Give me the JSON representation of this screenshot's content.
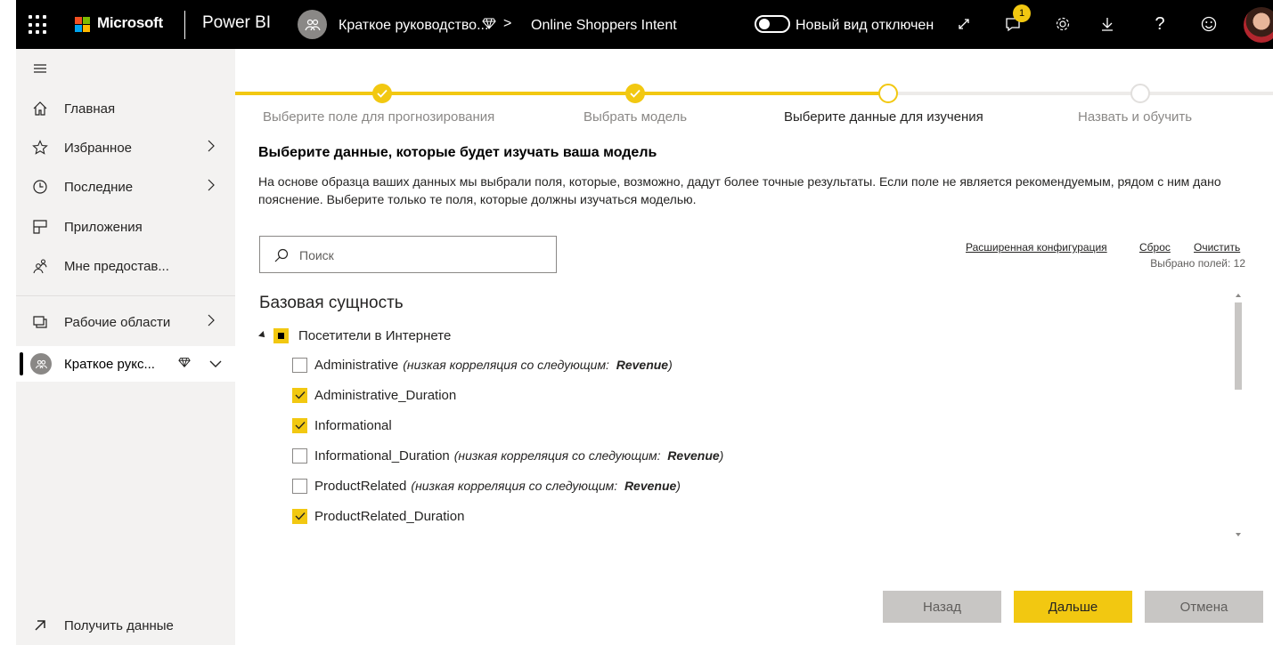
{
  "topbar": {
    "brand": "Microsoft",
    "app_name": "Power BI",
    "breadcrumb_workspace": "Краткое руководство...",
    "breadcrumb_sep": ">",
    "breadcrumb_item": "Online Shoppers Intent",
    "toggle_label": "Новый вид отключен",
    "notification_count": "1",
    "icons": [
      "waffle-icon",
      "expand-icon",
      "notifications-icon",
      "settings-icon",
      "download-icon",
      "help-icon",
      "feedback-icon"
    ]
  },
  "sidebar": {
    "items": [
      {
        "label": "Главная",
        "icon": "home-icon"
      },
      {
        "label": "Избранное",
        "icon": "star-icon"
      },
      {
        "label": "Последние",
        "icon": "clock-icon"
      },
      {
        "label": "Приложения",
        "icon": "apps-icon"
      },
      {
        "label": "Мне предостав...",
        "icon": "shared-icon"
      },
      {
        "label": "Рабочие области",
        "icon": "workspaces-icon"
      },
      {
        "label": "Краткое рукс...",
        "icon": "workspace-avatar"
      }
    ],
    "get_data": "Получить данные"
  },
  "steps": [
    {
      "label": "Выберите поле для прогнозирования",
      "state": "done"
    },
    {
      "label": "Выбрать модель",
      "state": "done"
    },
    {
      "label": "Выберите данные для изучения",
      "state": "current"
    },
    {
      "label": "Назвать и обучить",
      "state": "pending"
    }
  ],
  "main": {
    "title": "Выберите данные, которые будет изучать ваша модель",
    "description": "На основе образца ваших данных мы выбрали поля, которые, возможно, дадут более точные результаты. Если поле не является рекомендуемым, рядом с ним дано пояснение. Выберите только те поля, которые должны изучаться моделью.",
    "search_placeholder": "Поиск",
    "advanced_config": "Расширенная конфигурация",
    "reset": "Сброс",
    "clear": "Очистить",
    "selected_count": "Выбрано полей: 12",
    "entity_heading": "Базовая сущность",
    "root_entity": "Посетители в Интернете",
    "fields": [
      {
        "name": "Administrative",
        "checked": false,
        "note": "(низкая корреляция со следующим:",
        "note_target": "Revenue",
        "note_end": ")"
      },
      {
        "name": "Administrative_Duration",
        "checked": true,
        "note": "",
        "note_target": "",
        "note_end": ""
      },
      {
        "name": "Informational",
        "checked": true,
        "note": "",
        "note_target": "",
        "note_end": ""
      },
      {
        "name": "Informational_Duration",
        "checked": false,
        "note": "(низкая корреляция со следующим:",
        "note_target": "Revenue",
        "note_end": ")"
      },
      {
        "name": "ProductRelated",
        "checked": false,
        "note": "(низкая корреляция со следующим:",
        "note_target": "Revenue",
        "note_end": ")"
      },
      {
        "name": "ProductRelated_Duration",
        "checked": true,
        "note": "",
        "note_target": "",
        "note_end": ""
      }
    ],
    "buttons": {
      "back": "Назад",
      "next": "Дальше",
      "cancel": "Отмена"
    }
  },
  "colors": {
    "accent": "#f2c811",
    "topbar": "#000000",
    "nav_bg": "#f3f2f1"
  }
}
